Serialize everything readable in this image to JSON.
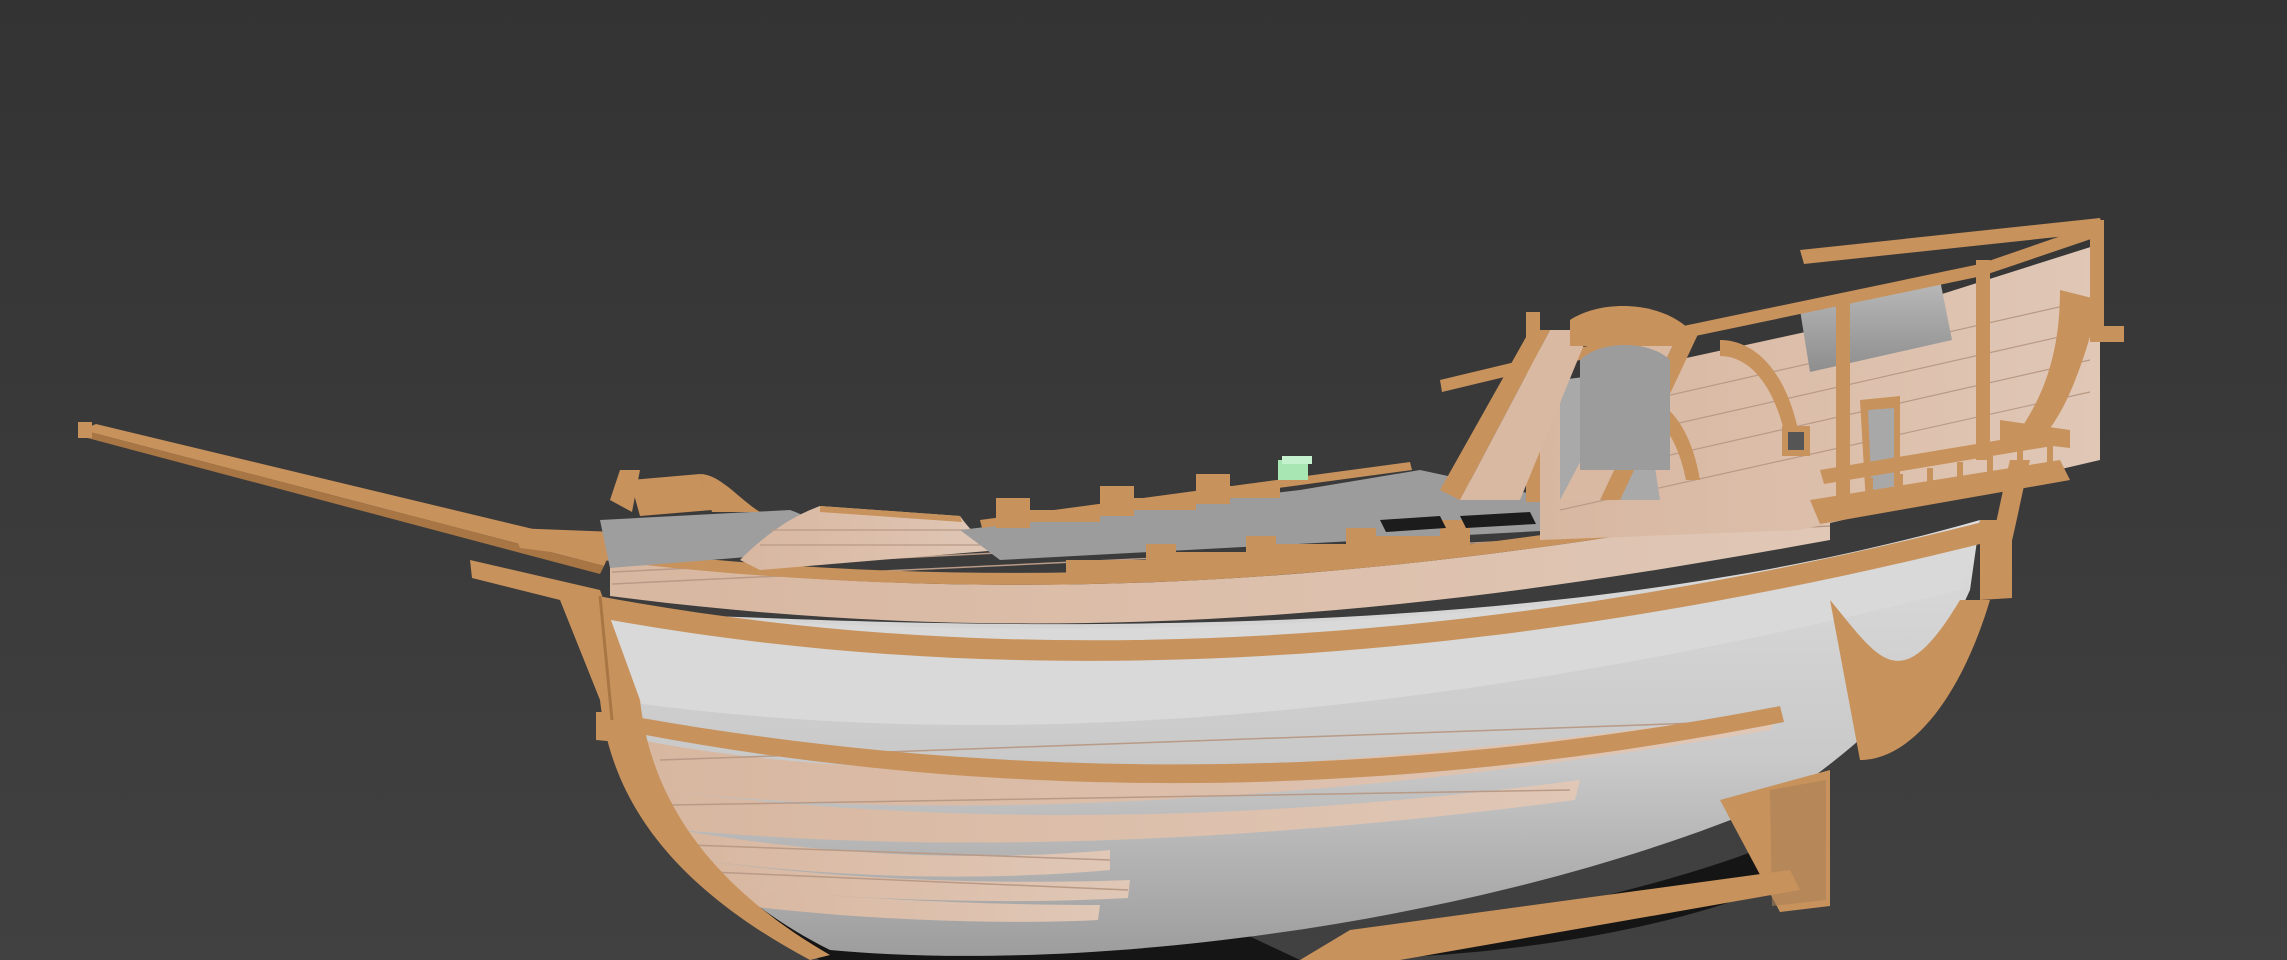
{
  "viewport": {
    "background": "#3a3a3a",
    "background_top": "#333333",
    "background_bottom": "#404040"
  },
  "model": {
    "wood_color": "#c8925c",
    "wood_light": "#d9a672",
    "plank_color": "#d8b9a3",
    "plank_line": "#b89a86",
    "hull_white": "#d4d4d4",
    "hull_shadow": "#9a9a9a",
    "gizmo_color": "#a8e6b4"
  }
}
